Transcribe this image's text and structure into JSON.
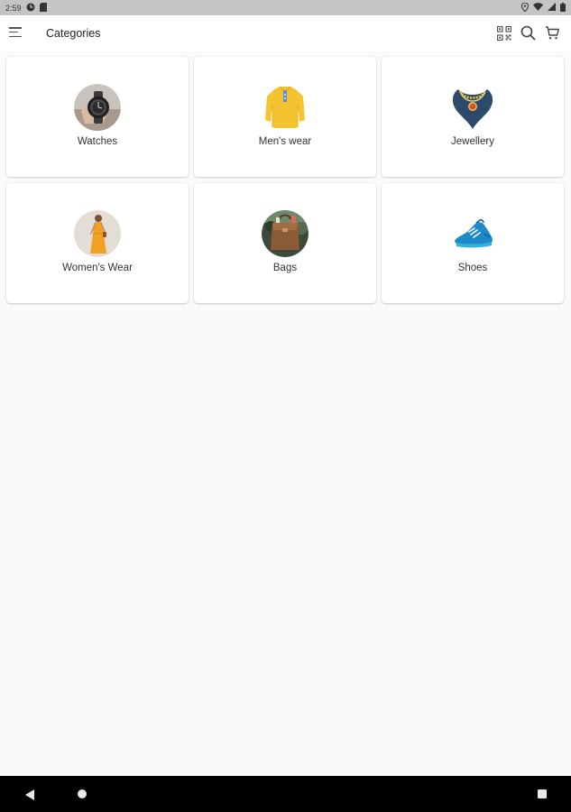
{
  "status_bar": {
    "time": "2:59",
    "icons": [
      "data-saver-icon",
      "sd-card-icon",
      "location-icon",
      "wifi-icon",
      "signal-icon",
      "battery-icon"
    ]
  },
  "app_bar": {
    "title": "Categories",
    "actions": [
      "qr-code-icon",
      "search-icon",
      "cart-icon"
    ]
  },
  "categories": [
    {
      "label": "Watches",
      "icon": "watch-image"
    },
    {
      "label": "Men's wear",
      "icon": "shirt-image"
    },
    {
      "label": "Jewellery",
      "icon": "necklace-image"
    },
    {
      "label": "Women's Wear",
      "icon": "women-dress-image"
    },
    {
      "label": "Bags",
      "icon": "bag-image"
    },
    {
      "label": "Shoes",
      "icon": "shoe-image"
    }
  ],
  "nav_bar": {
    "buttons": [
      "back-icon",
      "home-icon",
      "recents-icon"
    ]
  },
  "colors": {
    "background": "#fafafa",
    "card": "#ffffff",
    "status_bar": "#c4c4c4",
    "nav_bar": "#000000",
    "shirt_yellow": "#f4c430",
    "necklace_navy": "#2d4a6b",
    "shoe_blue": "#1e88c9"
  }
}
